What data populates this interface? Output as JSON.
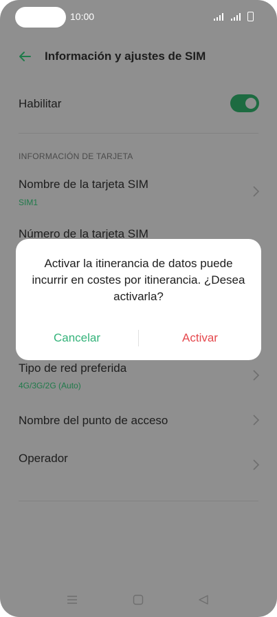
{
  "status_bar": {
    "time": "10:00"
  },
  "header": {
    "title": "Información y ajustes de SIM"
  },
  "rows": {
    "habilitar": {
      "label": "Habilitar"
    },
    "section_title": "INFORMACIÓN DE TARJETA",
    "sim_name": {
      "label": "Nombre de la tarjeta SIM",
      "value": "SIM1"
    },
    "sim_number": {
      "label": "Número de la tarjeta SIM"
    },
    "network_type": {
      "label": "Tipo de red preferida",
      "value": "4G/3G/2G (Auto)"
    },
    "apn": {
      "label": "Nombre del punto de acceso"
    },
    "operator": {
      "label": "Operador"
    }
  },
  "dialog": {
    "message": "Activar la itinerancia de datos puede incurrir en costes por itinerancia. ¿Desea activarla?",
    "cancel_label": "Cancelar",
    "confirm_label": "Activar"
  },
  "colors": {
    "accent_green": "#34b37a",
    "toggle_on": "#1d6b41",
    "destructive_red": "#e5484d",
    "scrim": "#8f8f8f"
  },
  "icons": [
    "back-arrow-icon",
    "chevron-right-icon",
    "menu-icon",
    "home-icon",
    "back-triangle-icon",
    "signal-icon",
    "battery-icon"
  ]
}
